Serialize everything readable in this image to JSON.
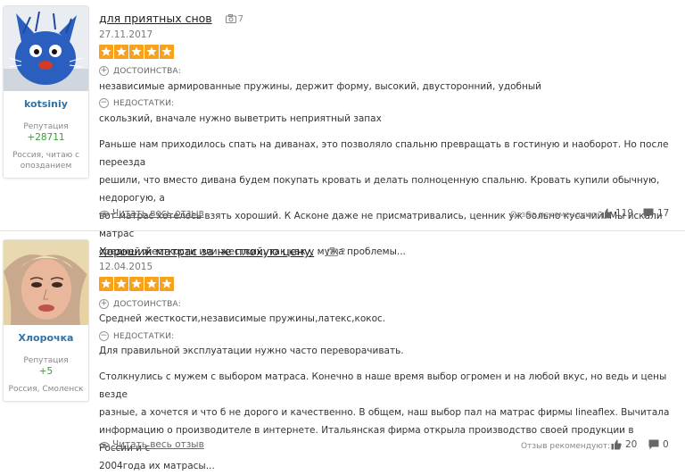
{
  "reviews": [
    {
      "author": "kotsiniy",
      "reputation_label": "Репутация",
      "reputation": "+28711",
      "location": "Россия, читаю с опозданием",
      "title": "для приятных снов",
      "photo_count": "7",
      "date": "27.11.2017",
      "rating": 5,
      "pros_label": "ДОСТОИНСТВА:",
      "pros": "независимые армированные пружины, держит форму, высокий, двусторонний, удобный",
      "cons_label": "НЕДОСТАТКИ:",
      "cons": "скользкий, вначале нужно выветрить неприятный запах",
      "body_lines": [
        "Раньше нам приходилось спать на диванах, это позволяло спальню превращать в гостиную и наоборот. Но после переезда",
        "решили, что вместо дивана будем покупать кровать и делать полноценную спальню. Кровать купили обычную, недорогую, а",
        "вот матрас хотелось взять хороший. К Асконе даже не присматривались, ценник уж больно кусачий. Мы искали матрас",
        "средней жесткости или жесткий, так как у мужа проблемы..."
      ],
      "read_more": "Читать весь отзыв",
      "recommend_label": "Отзыв рекомендуют:",
      "likes": "119",
      "comments": "17"
    },
    {
      "author": "Хлорочка",
      "reputation_label": "Репутация",
      "reputation": "+5",
      "location": "Россия, Смоленск",
      "title": "Хороший матрас за не плохую цену.",
      "photo_count": "2",
      "date": "12.04.2015",
      "rating": 5,
      "pros_label": "ДОСТОИНСТВА:",
      "pros": "Средней жесткости,независимые пружины,латекс,кокос.",
      "cons_label": "НЕДОСТАТКИ:",
      "cons": "Для правильной эксплуатации нужно часто переворачивать.",
      "body_lines": [
        "Столкнулись с мужем с выбором матраса. Конечно в наше время выбор огромен и на любой вкус, но ведь и цены везде",
        "разные, а хочется и что б не дорого и качественно. В общем, наш выбор пал на матрас фирмы lineaflex. Вычитала",
        "информацию о производителе в интернете. Итальянская фирма открыла производство своей продукции в России и с",
        "2004года их матрасы..."
      ],
      "read_more": "Читать весь отзыв",
      "recommend_label": "Отзыв рекомендуют:",
      "likes": "20",
      "comments": "0"
    }
  ],
  "colors": {
    "star": "#f7a21b",
    "link": "#2f73a6",
    "reputation": "#3a9a3a"
  }
}
